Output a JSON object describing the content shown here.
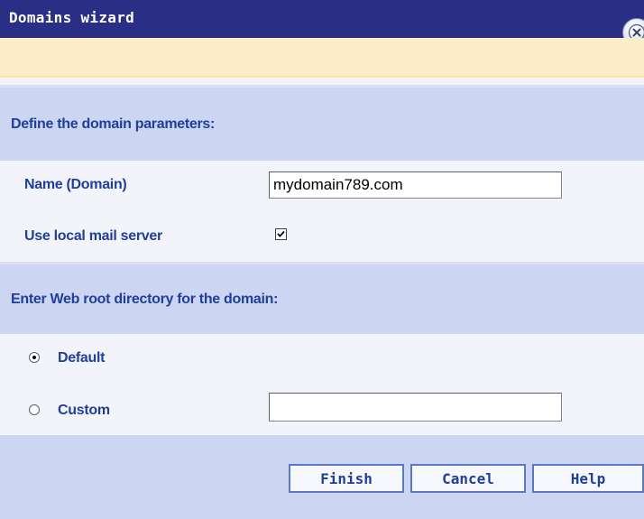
{
  "window": {
    "title": "Domains wizard"
  },
  "sections": {
    "domain_params": {
      "heading": "Define the domain parameters:"
    },
    "web_root": {
      "heading": "Enter Web root directory for the domain:"
    }
  },
  "form": {
    "name_label": "Name (Domain)",
    "name_value": "mydomain789.com",
    "mail_label": "Use local mail server",
    "mail_checked": true,
    "default_label": "Default",
    "custom_label": "Custom",
    "custom_value": "",
    "selected_web_root": "Default"
  },
  "buttons": {
    "finish": "Finish",
    "cancel": "Cancel",
    "help": "Help"
  },
  "icons": {
    "close": "close-icon",
    "check": "check-icon"
  },
  "colors": {
    "title_bar": "#2b2e85",
    "notice_strip": "#faedc7",
    "section_bg": "#ccd5f2",
    "label_text": "#1f3f99",
    "button_border": "#5979c2"
  }
}
